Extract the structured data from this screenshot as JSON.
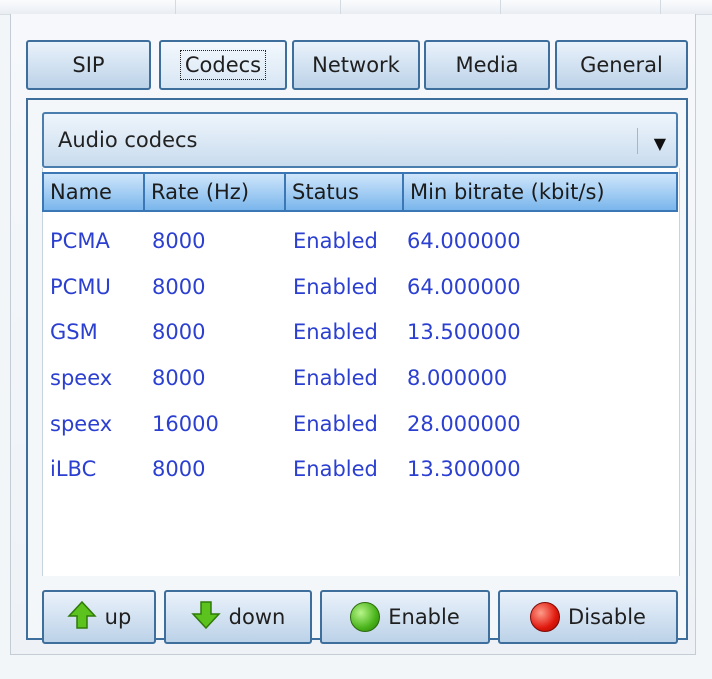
{
  "tabs": [
    {
      "label": "SIP"
    },
    {
      "label": "Codecs"
    },
    {
      "label": "Network"
    },
    {
      "label": "Media"
    },
    {
      "label": "General"
    }
  ],
  "codec_select": {
    "value": "Audio codecs"
  },
  "columns": [
    "Name",
    "Rate (Hz)",
    "Status",
    "Min bitrate (kbit/s)"
  ],
  "rows": [
    {
      "name": "PCMA",
      "rate": "8000",
      "status": "Enabled",
      "bitrate": "64.000000"
    },
    {
      "name": "PCMU",
      "rate": "8000",
      "status": "Enabled",
      "bitrate": "64.000000"
    },
    {
      "name": "GSM",
      "rate": "8000",
      "status": "Enabled",
      "bitrate": "13.500000"
    },
    {
      "name": "speex",
      "rate": "8000",
      "status": "Enabled",
      "bitrate": "8.000000"
    },
    {
      "name": "speex",
      "rate": "16000",
      "status": "Enabled",
      "bitrate": "28.000000"
    },
    {
      "name": "iLBC",
      "rate": "8000",
      "status": "Enabled",
      "bitrate": "13.300000"
    }
  ],
  "buttons": {
    "up": "up",
    "down": "down",
    "enable": "Enable",
    "disable": "Disable"
  },
  "icons": {
    "up": "green-up-arrow-icon",
    "down": "green-down-arrow-icon",
    "enable": "green-circle-icon",
    "disable": "red-circle-icon"
  },
  "colors": {
    "accent": "#3e6f9c",
    "header": "#7ab6ec",
    "row_text": "#2b3fd0"
  }
}
